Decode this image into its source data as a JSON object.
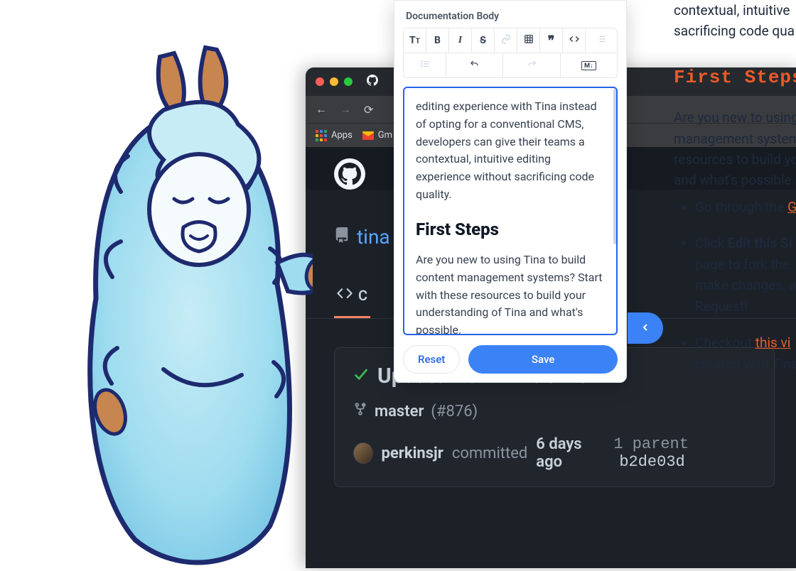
{
  "browser": {
    "bookmarks": {
      "apps": "Apps",
      "gmail": "Gm"
    }
  },
  "github": {
    "repo_partial": "tina",
    "code_tab": "C",
    "commit": {
      "title": "Update from TinaCMS",
      "branch": "master",
      "pr": "(#876)",
      "user": "perkinsjr",
      "verb": "committed",
      "time": "6 days ago",
      "parent_label": "1 parent",
      "sha": "b2de03d"
    }
  },
  "editor": {
    "title": "Documentation Body",
    "toolbar": {
      "heading": "heading",
      "bold": "bold",
      "italic": "italic",
      "strike": "strikethrough",
      "link": "link",
      "table": "table",
      "quote": "quote",
      "code": "code",
      "list": "list",
      "ul": "unordered-list",
      "ol": "ordered-list",
      "undo": "undo",
      "redo": "redo",
      "markdown": "markdown"
    },
    "body_p1": "editing experience with Tina instead of opting for a conventional CMS, developers can give their teams a contextual, intuitive editing experience without sacrificing code quality.",
    "body_h": "First Steps",
    "body_p2": "Are you new to using Tina to build content management systems? Start with these resources to build your understanding of Tina and what's possible.",
    "reset": "Reset",
    "save": "Save"
  },
  "preview": {
    "intro_frag": "contextual, intuitive sacrificing code qua",
    "heading": "First Steps",
    "p1": "Are you new to using management system resources to build yo and what's possible.",
    "li1_a": "Go through the ",
    "li2_a": "Click ",
    "li2_b": "Edit this Si",
    "li2_c": "page to fork the ",
    "li2_d": "make changes, a",
    "li2_e": "Request!",
    "li3_a": "Checkout ",
    "li3_link": "this vi",
    "li3_b": "created with Tina"
  }
}
